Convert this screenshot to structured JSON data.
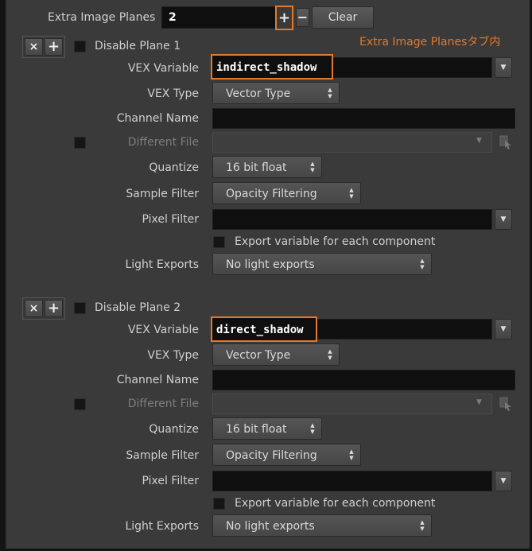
{
  "header": {
    "count_label": "Extra Image Planes",
    "count_value": "2",
    "plus_icon": "+",
    "minus_icon": "−",
    "clear_label": "Clear"
  },
  "annotation": {
    "text": "Extra Image Planesタブ内",
    "color": "#e07a2c"
  },
  "icons": {
    "remove": "×",
    "add": "+",
    "dropdown": "▼",
    "spinner": "▲▼",
    "file_chooser": "file-chooser-icon"
  },
  "planes": [
    {
      "disable_label": "Disable Plane 1",
      "vex_variable_label": "VEX Variable",
      "vex_variable_value": "indirect_shadow",
      "vex_type_label": "VEX Type",
      "vex_type_value": "Vector Type",
      "channel_name_label": "Channel Name",
      "different_file_label": "Different File",
      "quantize_label": "Quantize",
      "quantize_value": "16 bit float",
      "sample_filter_label": "Sample Filter",
      "sample_filter_value": "Opacity Filtering",
      "pixel_filter_label": "Pixel Filter",
      "export_label": "Export variable for each component",
      "light_exports_label": "Light Exports",
      "light_exports_value": "No light exports"
    },
    {
      "disable_label": "Disable Plane 2",
      "vex_variable_label": "VEX Variable",
      "vex_variable_value": "direct_shadow",
      "vex_type_label": "VEX Type",
      "vex_type_value": "Vector Type",
      "channel_name_label": "Channel Name",
      "different_file_label": "Different File",
      "quantize_label": "Quantize",
      "quantize_value": "16 bit float",
      "sample_filter_label": "Sample Filter",
      "sample_filter_value": "Opacity Filtering",
      "pixel_filter_label": "Pixel Filter",
      "export_label": "Export variable for each component",
      "light_exports_label": "Light Exports",
      "light_exports_value": "No light exports"
    }
  ]
}
